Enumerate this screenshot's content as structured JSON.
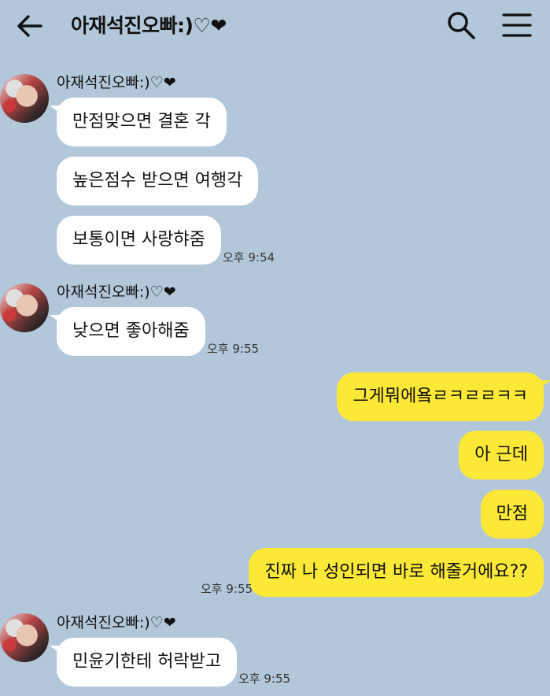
{
  "header": {
    "title": "아재석진오빠:)♡❤",
    "back_icon": "arrow-left-icon",
    "search_icon": "search-icon",
    "menu_icon": "menu-icon"
  },
  "colors": {
    "background": "#b2c7da",
    "incoming_bubble": "#ffffff",
    "outgoing_bubble": "#fce837"
  },
  "messages": [
    {
      "sender": "아재석진오빠:)♡❤",
      "bubbles": [
        "만점맞으면 결혼 각",
        "높은점수 받으면 여행각",
        "보통이면 사랑햐줌"
      ],
      "time": "오후 9:54"
    },
    {
      "sender": "아재석진오빠:)♡❤",
      "bubbles": [
        "낮으면 좋아해줌"
      ],
      "time": "오후 9:55"
    },
    {
      "sender": "me",
      "bubbles": [
        "그게뭐에욬ㄹㅋㄹㄹㅋㅋ",
        "아 근데",
        "만점",
        "진짜 나 성인되면 바로 해줄거에요??"
      ],
      "time": "오후 9:55"
    },
    {
      "sender": "아재석진오빠:)♡❤",
      "bubbles": [
        "민윤기한테 허락받고"
      ],
      "time": "오후 9:55"
    }
  ]
}
